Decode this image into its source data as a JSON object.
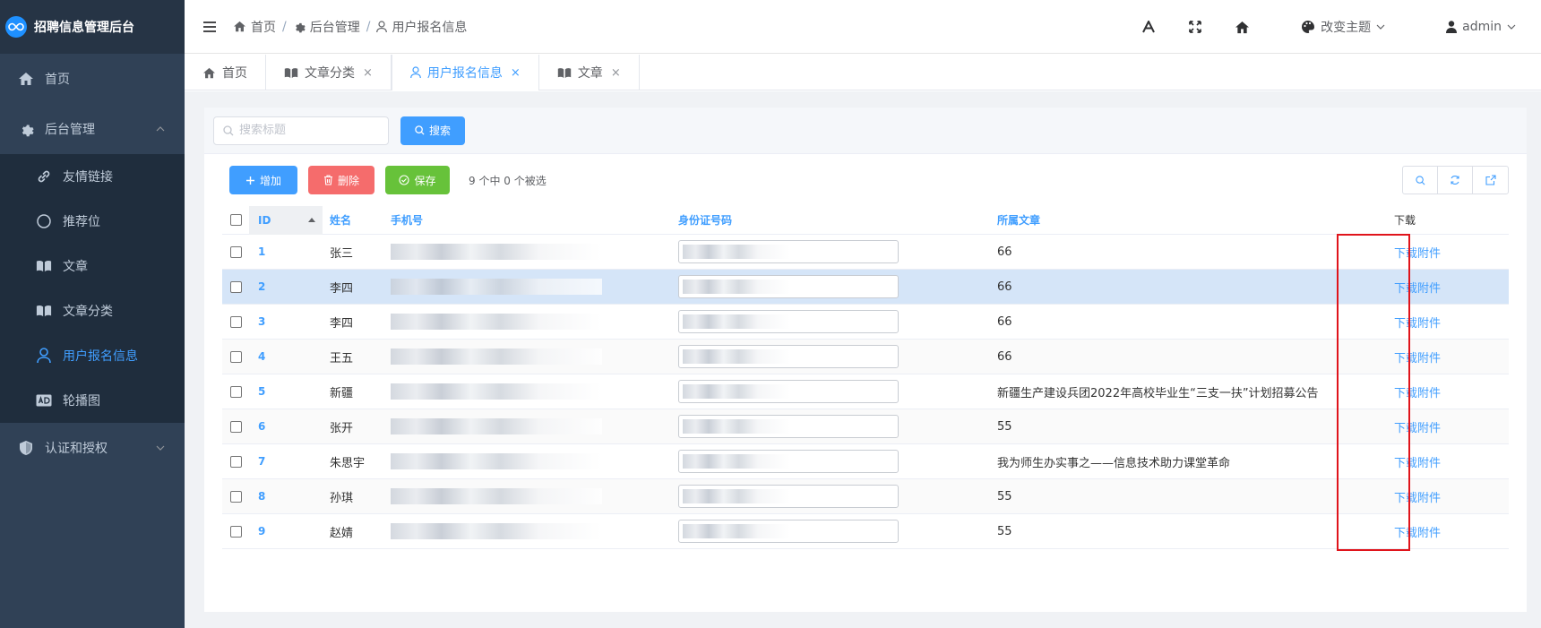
{
  "app": {
    "title": "招聘信息管理后台"
  },
  "sidebar": {
    "items": [
      {
        "label": "首页"
      },
      {
        "label": "后台管理"
      },
      {
        "label": "认证和授权"
      }
    ],
    "submenu": [
      {
        "label": "友情链接"
      },
      {
        "label": "推荐位"
      },
      {
        "label": "文章"
      },
      {
        "label": "文章分类"
      },
      {
        "label": "用户报名信息"
      },
      {
        "label": "轮播图"
      }
    ]
  },
  "header": {
    "breadcrumb": [
      "首页",
      "后台管理",
      "用户报名信息"
    ],
    "separator": "/",
    "theme_label": "改变主题",
    "user": "admin"
  },
  "tabs": [
    {
      "label": "首页"
    },
    {
      "label": "文章分类",
      "close": "×"
    },
    {
      "label": "用户报名信息",
      "close": "×"
    },
    {
      "label": "文章",
      "close": "×"
    }
  ],
  "search": {
    "placeholder": "搜索标题",
    "button": "搜索"
  },
  "toolbar": {
    "add": "增加",
    "delete": "删除",
    "save": "保存",
    "selection_info": "9 个中 0 个被选"
  },
  "table": {
    "headers": {
      "id": "ID",
      "name": "姓名",
      "phone": "手机号",
      "idcard": "身份证号码",
      "article": "所属文章",
      "download": "下载"
    },
    "rows": [
      {
        "id": "1",
        "name": "张三",
        "article": "66",
        "download": "下载附件"
      },
      {
        "id": "2",
        "name": "李四",
        "article": "66",
        "download": "下载附件"
      },
      {
        "id": "3",
        "name": "李四",
        "article": "66",
        "download": "下载附件"
      },
      {
        "id": "4",
        "name": "王五",
        "article": "66",
        "download": "下载附件"
      },
      {
        "id": "5",
        "name": "新疆",
        "article": "新疆生产建设兵团2022年高校毕业生“三支一扶”计划招募公告",
        "download": "下载附件"
      },
      {
        "id": "6",
        "name": "张开",
        "article": "55",
        "download": "下载附件"
      },
      {
        "id": "7",
        "name": "朱思宇",
        "article": "我为师生办实事之——信息技术助力课堂革命",
        "download": "下载附件"
      },
      {
        "id": "8",
        "name": "孙琪",
        "article": "55",
        "download": "下载附件"
      },
      {
        "id": "9",
        "name": "赵婧",
        "article": "55",
        "download": "下载附件"
      }
    ]
  },
  "colors": {
    "sidebar_bg": "#304156",
    "accent": "#409eff",
    "danger": "#f56c6c",
    "success": "#67c23a",
    "highlight": "#e0141b"
  }
}
